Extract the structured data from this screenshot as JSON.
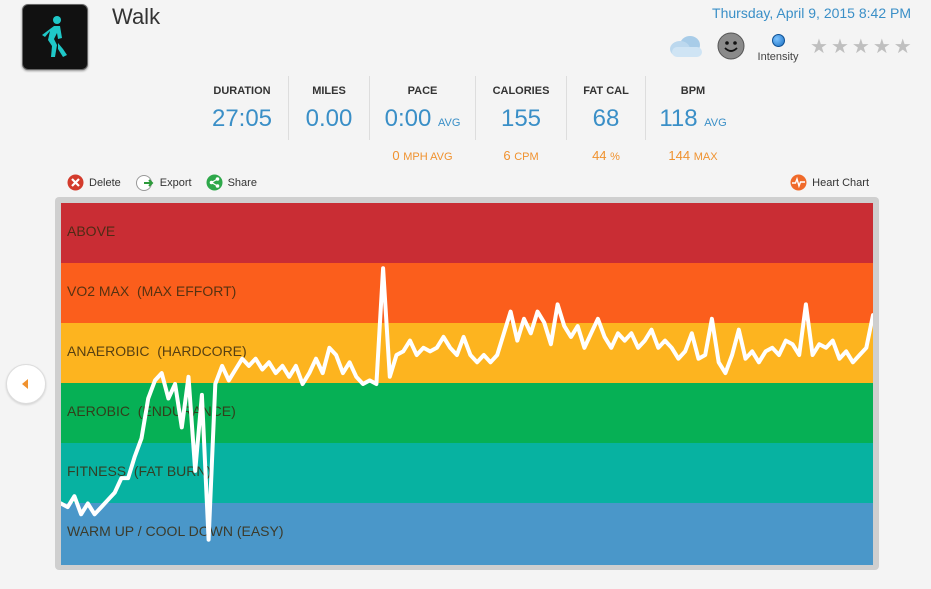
{
  "header": {
    "title": "Walk",
    "datetime": "Thursday, April 9, 2015 8:42 PM",
    "activity_icon": "walking-person-icon",
    "weather_icon": "cloudy-icon",
    "mood_icon": "smiley-icon",
    "intensity_label": "Intensity",
    "rating": {
      "value": 0,
      "max": 5
    }
  },
  "stats": [
    {
      "key": "duration",
      "label": "DURATION",
      "value": "27:05",
      "unit": "",
      "sub_value": "",
      "sub_unit": ""
    },
    {
      "key": "miles",
      "label": "MILES",
      "value": "0.00",
      "unit": "",
      "sub_value": "",
      "sub_unit": ""
    },
    {
      "key": "pace",
      "label": "PACE",
      "value": "0:00",
      "unit": "AVG",
      "sub_value": "0",
      "sub_unit": "MPH AVG"
    },
    {
      "key": "calories",
      "label": "CALORIES",
      "value": "155",
      "unit": "",
      "sub_value": "6",
      "sub_unit": "CPM"
    },
    {
      "key": "fatcal",
      "label": "FAT CAL",
      "value": "68",
      "unit": "",
      "sub_value": "44",
      "sub_unit": "%"
    },
    {
      "key": "bpm",
      "label": "BPM",
      "value": "118",
      "unit": "AVG",
      "sub_value": "144",
      "sub_unit": "MAX"
    }
  ],
  "actions": {
    "delete": "Delete",
    "export": "Export",
    "share": "Share",
    "heart_chart": "Heart Chart"
  },
  "colors": {
    "accent_blue": "#3a8fc7",
    "accent_orange": "#f0922f"
  },
  "zones": [
    {
      "label": "ABOVE",
      "color": "#c92d34"
    },
    {
      "label": "VO2 MAX  (MAX EFFORT)",
      "color": "#fb5e1c"
    },
    {
      "label": "ANAEROBIC  (HARDCORE)",
      "color": "#fdb41f"
    },
    {
      "label": "AEROBIC  (ENDURANCE)",
      "color": "#06b055"
    },
    {
      "label": "FITNESS  (FAT BURN)",
      "color": "#07b2a1"
    },
    {
      "label": "WARM UP / COOL DOWN (EASY)",
      "color": "#4a97c9"
    }
  ],
  "chart_data": {
    "type": "line",
    "series": [
      {
        "values": [
          0.17,
          0.16,
          0.19,
          0.14,
          0.17,
          0.14,
          0.16,
          0.18,
          0.2,
          0.24,
          0.24,
          0.3,
          0.35,
          0.46,
          0.51,
          0.53,
          0.46,
          0.5,
          0.38,
          0.52,
          0.26,
          0.47,
          0.07,
          0.5,
          0.55,
          0.51,
          0.54,
          0.57,
          0.55,
          0.57,
          0.54,
          0.56,
          0.53,
          0.55,
          0.52,
          0.55,
          0.5,
          0.53,
          0.57,
          0.53,
          0.6,
          0.58,
          0.53,
          0.56,
          0.52,
          0.5,
          0.51,
          0.5,
          0.82,
          0.52,
          0.58,
          0.59,
          0.62,
          0.58,
          0.6,
          0.59,
          0.6,
          0.63,
          0.6,
          0.58,
          0.63,
          0.58,
          0.56,
          0.58,
          0.56,
          0.58,
          0.64,
          0.7,
          0.62,
          0.68,
          0.64,
          0.7,
          0.67,
          0.61,
          0.72,
          0.66,
          0.63,
          0.66,
          0.6,
          0.64,
          0.68,
          0.63,
          0.6,
          0.64,
          0.62,
          0.64,
          0.6,
          0.62,
          0.65,
          0.6,
          0.62,
          0.6,
          0.57,
          0.59,
          0.64,
          0.57,
          0.58,
          0.68,
          0.56,
          0.53,
          0.58,
          0.65,
          0.57,
          0.59,
          0.56,
          0.59,
          0.6,
          0.58,
          0.62,
          0.61,
          0.58,
          0.72,
          0.58,
          0.61,
          0.6,
          0.62,
          0.57,
          0.59,
          0.56,
          0.58,
          0.6,
          0.69
        ]
      }
    ],
    "ylim": [
      0,
      1
    ],
    "grid": false
  }
}
